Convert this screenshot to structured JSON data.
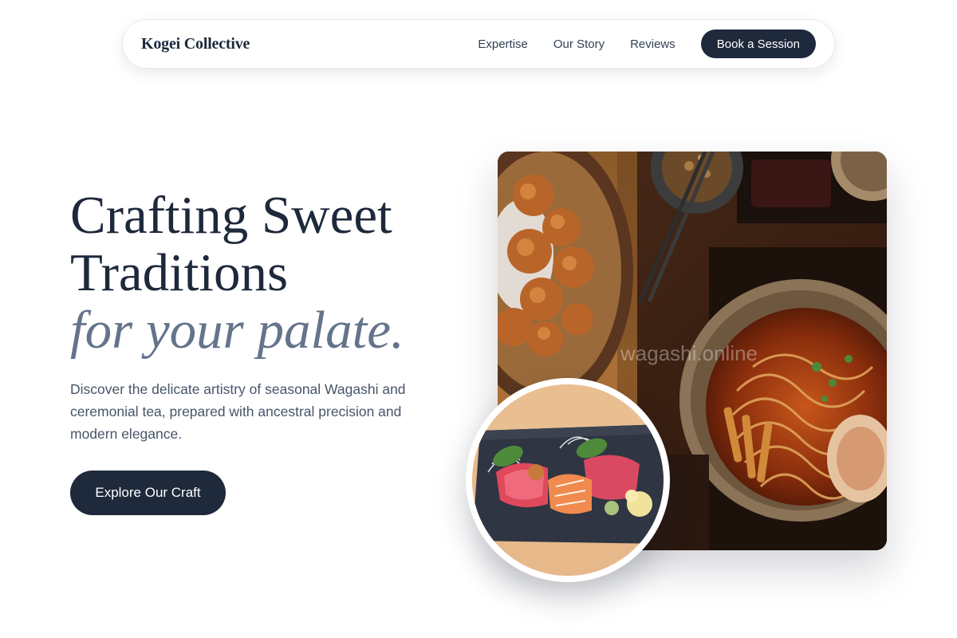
{
  "nav": {
    "logo": "Kogei Collective",
    "links": [
      "Expertise",
      "Our Story",
      "Reviews"
    ],
    "cta": "Book a Session"
  },
  "hero": {
    "title_line1": "Crafting Sweet",
    "title_line2": "Traditions",
    "title_accent": "for your palate.",
    "description": "Discover the delicate artistry of seasonal Wagashi and ceremonial tea, prepared with ancestral precision and modern elegance.",
    "cta": "Explore Our Craft"
  },
  "images": {
    "main_watermark": "wagashi.online",
    "colors": {
      "primary": "#1e293b",
      "muted": "#64748b",
      "body_text": "#475569"
    }
  }
}
